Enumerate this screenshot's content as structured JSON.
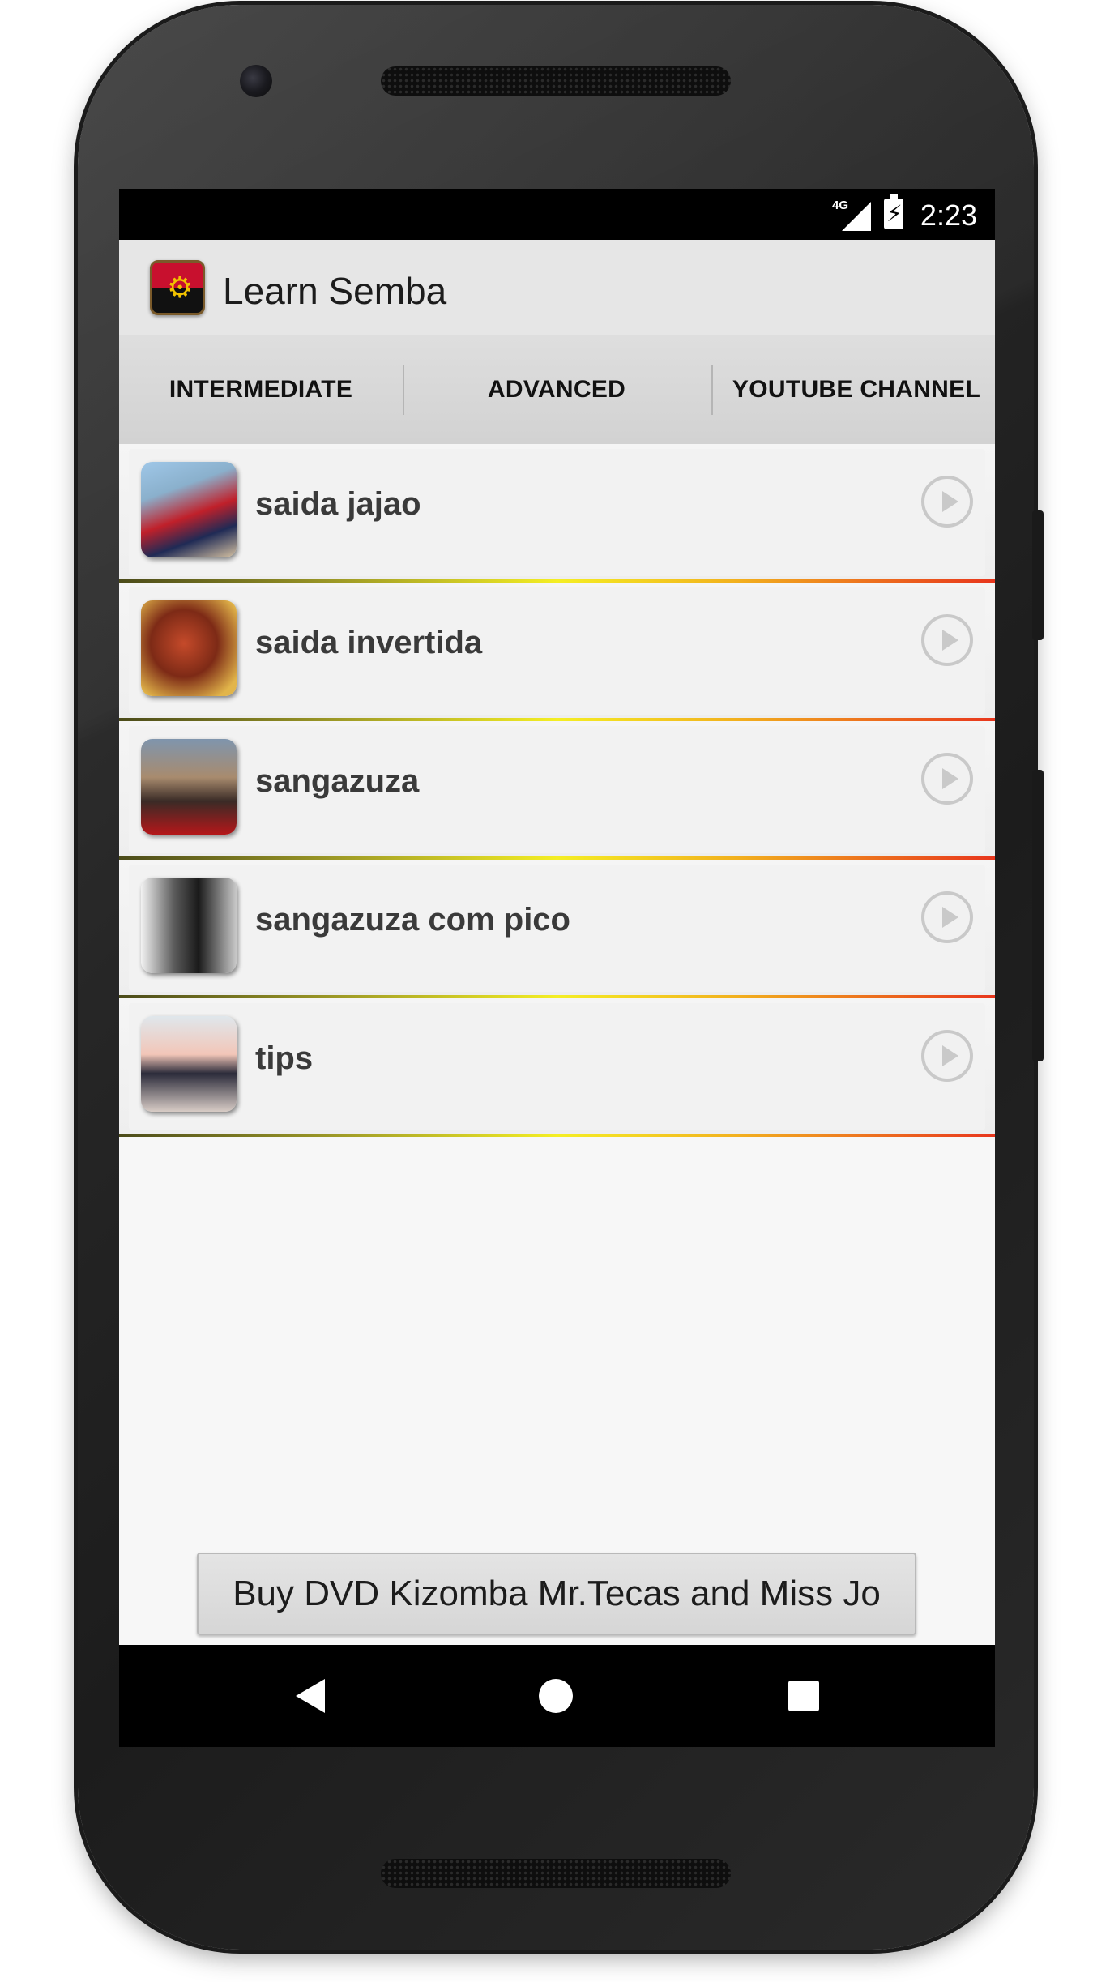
{
  "status_bar": {
    "network": "4G",
    "time": "2:23"
  },
  "app": {
    "title": "Learn Semba",
    "logo_icon": "angola-flag-icon"
  },
  "tabs": [
    {
      "label": "INTERMEDIATE",
      "selected": false
    },
    {
      "label": "ADVANCED",
      "selected": true
    },
    {
      "label": "YOUTUBE CHANNEL",
      "selected": false
    }
  ],
  "colors": {
    "tab_indicator": "#2aa7df",
    "separator_gradient": [
      "#4b4b1a",
      "#f4ee24",
      "#e8361d"
    ]
  },
  "videos": [
    {
      "title": "saida jajao",
      "thumbnail_icon": "video-thumbnail"
    },
    {
      "title": "saida invertida",
      "thumbnail_icon": "video-thumbnail"
    },
    {
      "title": "sangazuza",
      "thumbnail_icon": "video-thumbnail"
    },
    {
      "title": "sangazuza com pico",
      "thumbnail_icon": "video-thumbnail"
    },
    {
      "title": "tips",
      "thumbnail_icon": "video-thumbnail"
    }
  ],
  "buy_button": {
    "label": "Buy DVD Kizomba Mr.Tecas and Miss Jo"
  },
  "nav": {
    "back_icon": "back-icon",
    "home_icon": "home-icon",
    "recents_icon": "recents-icon"
  }
}
